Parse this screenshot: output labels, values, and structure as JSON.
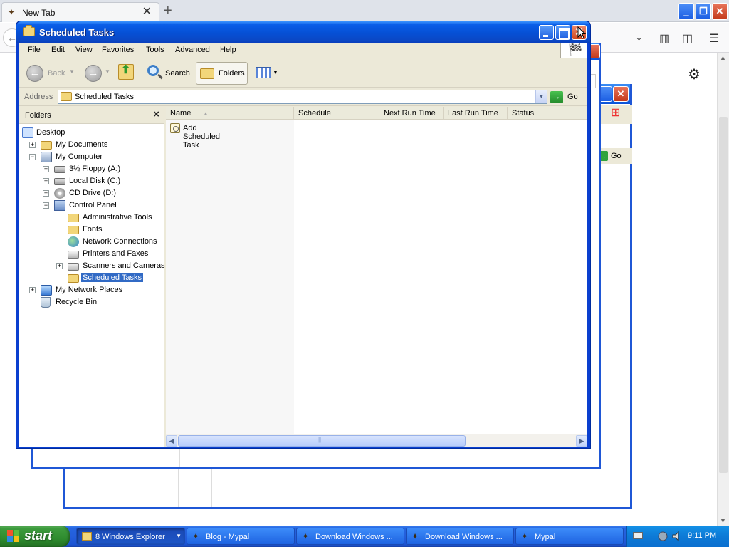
{
  "browser": {
    "tab_title": "New Tab",
    "tab_close": "✕",
    "new_tab": "+",
    "toolbar_icons": [
      "download-icon",
      "library-icon",
      "sidebar-icon",
      "menu-icon"
    ],
    "settings_icon": "gear-icon"
  },
  "window": {
    "title": "Scheduled Tasks",
    "close_glyph": "✕"
  },
  "menu": {
    "items": [
      "File",
      "Edit",
      "View",
      "Favorites",
      "Tools",
      "Advanced",
      "Help"
    ]
  },
  "toolbar": {
    "back_label": "Back",
    "search_label": "Search",
    "folders_label": "Folders"
  },
  "address": {
    "label": "Address",
    "value": "Scheduled Tasks",
    "go_label": "Go"
  },
  "folders_pane": {
    "title": "Folders",
    "close_glyph": "×",
    "tree": [
      {
        "label": "Desktop",
        "level": 0,
        "icon": "desktop-icon",
        "expander": "",
        "selected": false
      },
      {
        "label": "My Documents",
        "level": 1,
        "icon": "folder-icon",
        "expander": "+",
        "selected": false
      },
      {
        "label": "My Computer",
        "level": 1,
        "icon": "computer-icon",
        "expander": "−",
        "selected": false
      },
      {
        "label": "3½ Floppy (A:)",
        "level": 2,
        "icon": "floppy-icon",
        "expander": "+",
        "selected": false
      },
      {
        "label": "Local Disk (C:)",
        "level": 2,
        "icon": "disk-icon",
        "expander": "+",
        "selected": false
      },
      {
        "label": "CD Drive (D:)",
        "level": 2,
        "icon": "cd-icon",
        "expander": "+",
        "selected": false
      },
      {
        "label": "Control Panel",
        "level": 2,
        "icon": "control-panel-icon",
        "expander": "−",
        "selected": false
      },
      {
        "label": "Administrative Tools",
        "level": 3,
        "icon": "folder-icon",
        "expander": "",
        "selected": false
      },
      {
        "label": "Fonts",
        "level": 3,
        "icon": "folder-icon",
        "expander": "",
        "selected": false
      },
      {
        "label": "Network Connections",
        "level": 3,
        "icon": "globe-icon",
        "expander": "",
        "selected": false
      },
      {
        "label": "Printers and Faxes",
        "level": 3,
        "icon": "printer-icon",
        "expander": "",
        "selected": false
      },
      {
        "label": "Scanners and Cameras",
        "level": 3,
        "icon": "scanner-icon",
        "expander": "+",
        "selected": false
      },
      {
        "label": "Scheduled Tasks",
        "level": 3,
        "icon": "folder-icon",
        "expander": "",
        "selected": true
      },
      {
        "label": "My Network Places",
        "level": 1,
        "icon": "network-icon",
        "expander": "+",
        "selected": false
      },
      {
        "label": "Recycle Bin",
        "level": 1,
        "icon": "recycle-bin-icon",
        "expander": "",
        "selected": false
      }
    ]
  },
  "list": {
    "columns": [
      "Name",
      "Schedule",
      "Next Run Time",
      "Last Run Time",
      "Status"
    ],
    "sort_indicator": "▲",
    "rows": [
      {
        "name": "Add Scheduled Task"
      }
    ]
  },
  "taskbar": {
    "start_label": "start",
    "tasks": [
      {
        "label": "8 Windows Explorer",
        "active": true,
        "has_dropdown": true
      },
      {
        "label": "Blog - Mypal",
        "active": false,
        "has_dropdown": false
      },
      {
        "label": "Download Windows ...",
        "active": false,
        "has_dropdown": false
      },
      {
        "label": "Download Windows ...",
        "active": false,
        "has_dropdown": false
      },
      {
        "label": "Mypal",
        "active": false,
        "has_dropdown": false
      }
    ],
    "clock": "9:11 PM"
  }
}
